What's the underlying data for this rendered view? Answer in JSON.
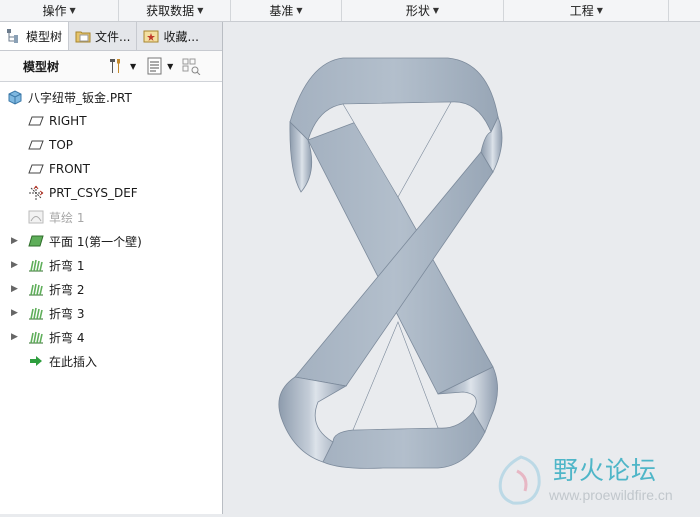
{
  "ribbon": {
    "groups": [
      "操作",
      "获取数据",
      "基准",
      "形状",
      "工程"
    ]
  },
  "panel": {
    "tabs": [
      "模型树",
      "文件...",
      "收藏..."
    ],
    "toolbar_label": "模型树"
  },
  "tree": {
    "root": "八字纽带_钣金.PRT",
    "datums": [
      "RIGHT",
      "TOP",
      "FRONT",
      "PRT_CSYS_DEF"
    ],
    "sketch": "草绘 1",
    "features": [
      "平面 1(第一个壁)",
      "折弯 1",
      "折弯 2",
      "折弯 3",
      "折弯 4"
    ],
    "insert_here": "在此插入"
  },
  "watermark": {
    "title": "野火论坛",
    "url": "www.proewildfire.cn"
  },
  "colors": {
    "part_fill": "#a8b5c4",
    "part_edge": "#6f7d8c",
    "viewport_bg": "#e9ebee",
    "watermark_accent": "#4fb6c8"
  }
}
